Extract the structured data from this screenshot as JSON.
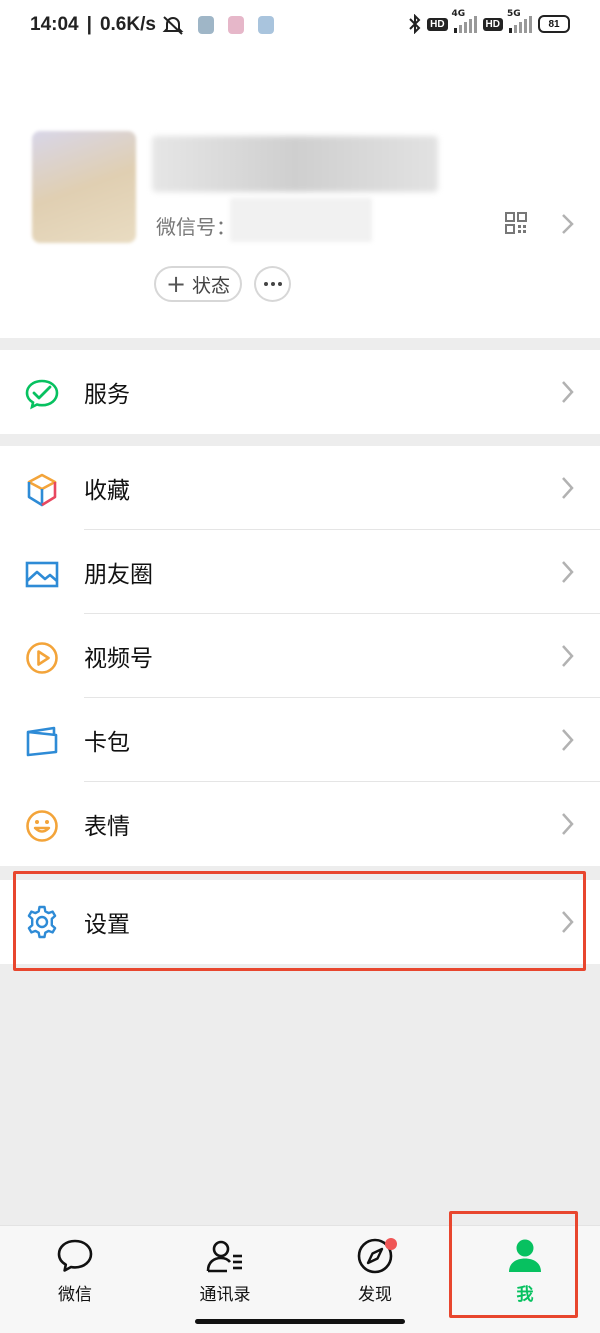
{
  "status_bar": {
    "time": "14:04",
    "speed": "0.6K/s",
    "network_1": "4G",
    "network_2": "5G",
    "hd": "HD",
    "battery": "81"
  },
  "profile": {
    "wechat_id_label": "微信号：",
    "status_button_label": "状态",
    "status_button_icon": "plus-icon",
    "more_icon": "more-dots-icon"
  },
  "menu": {
    "service": {
      "label": "服务",
      "icon": "wechat-pay-icon",
      "color": "#07c160"
    },
    "items": [
      {
        "label": "收藏",
        "icon": "favorites-cube-icon"
      },
      {
        "label": "朋友圈",
        "icon": "moments-picture-icon",
        "color": "#2e8bd6"
      },
      {
        "label": "视频号",
        "icon": "channels-play-icon",
        "color": "#f3a43a"
      },
      {
        "label": "卡包",
        "icon": "card-wallet-icon",
        "color": "#2e8bd6"
      },
      {
        "label": "表情",
        "icon": "emoji-smile-icon",
        "color": "#f3a43a"
      }
    ],
    "settings": {
      "label": "设置",
      "icon": "settings-gear-icon",
      "color": "#2e8bd6"
    }
  },
  "tabbar": {
    "tabs": [
      {
        "label": "微信",
        "icon": "chat-bubble-icon"
      },
      {
        "label": "通讯录",
        "icon": "contacts-icon"
      },
      {
        "label": "发现",
        "icon": "compass-icon",
        "has_dot": true
      },
      {
        "label": "我",
        "icon": "me-person-icon",
        "active": true
      }
    ],
    "active_color": "#07c160"
  },
  "annotation_color": "#e8462e"
}
